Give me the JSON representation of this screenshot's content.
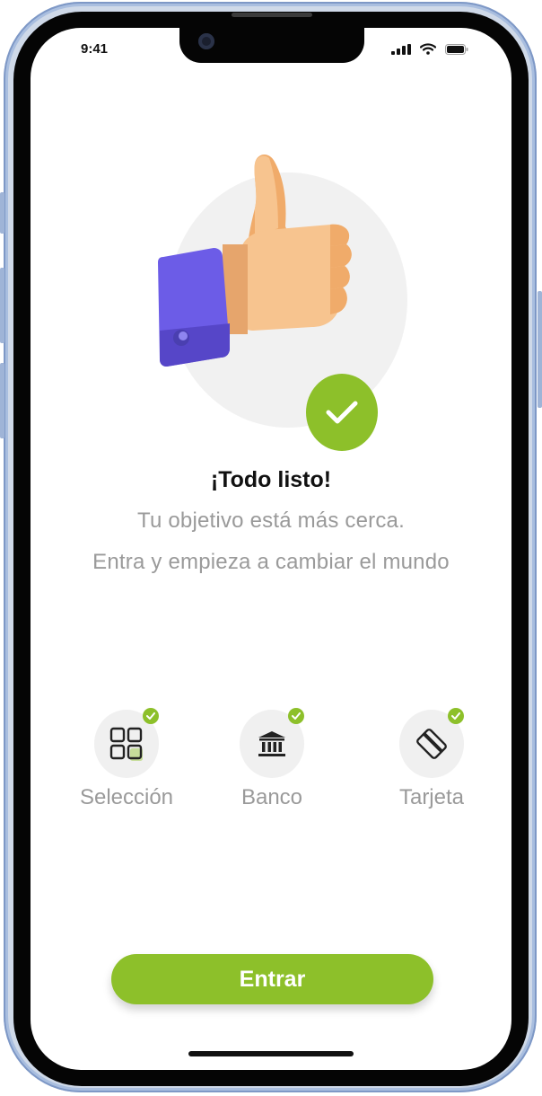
{
  "status_bar": {
    "time": "9:41"
  },
  "hero": {
    "title": "¡Todo listo!",
    "subtitle_line1": "Tu objetivo está más cerca.",
    "subtitle_line2": "Entra y empieza a cambiar el mundo"
  },
  "steps": [
    {
      "label": "Selección",
      "icon": "grid-icon",
      "done": true
    },
    {
      "label": "Banco",
      "icon": "bank-icon",
      "done": true
    },
    {
      "label": "Tarjeta",
      "icon": "card-icon",
      "done": true
    }
  ],
  "actions": {
    "enter_label": "Entrar"
  },
  "colors": {
    "accent": "#8dc02a",
    "muted_text": "#9a9a9a",
    "sleeve": "#6c5ce7",
    "skin": "#f6c391"
  }
}
